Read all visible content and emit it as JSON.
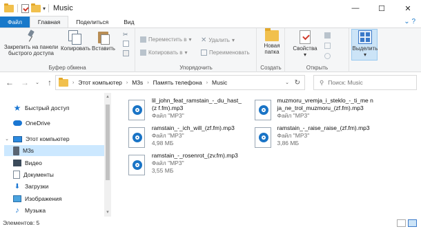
{
  "window": {
    "title": "Music",
    "controls": {
      "minimize": "—",
      "maximize": "☐",
      "close": "✕"
    }
  },
  "ribbon_tabs": [
    "Файл",
    "Главная",
    "Поделиться",
    "Вид"
  ],
  "ribbon": {
    "clipboard": {
      "pin_label": "Закрепить на панели быстрого доступа",
      "copy_label": "Копировать",
      "paste_label": "Вставить",
      "group_label": "Буфер обмена"
    },
    "organize": {
      "move_to": "Переместить в",
      "copy_to": "Копировать в",
      "delete": "Удалить",
      "rename": "Переименовать",
      "group_label": "Упорядочить"
    },
    "create": {
      "new_folder": "Новая папка",
      "group_label": "Создать"
    },
    "open": {
      "properties": "Свойства",
      "group_label": "Открыть"
    },
    "select": {
      "label": "Выделить"
    }
  },
  "address": {
    "crumbs": [
      "Этот компьютер",
      "M3s",
      "Память телефона",
      "Music"
    ],
    "search_placeholder": "Поиск: Music"
  },
  "nav_pane": [
    {
      "label": "Быстрый доступ",
      "icon": "star-icon",
      "expander": ""
    },
    {
      "label": "OneDrive",
      "icon": "cloud-icon",
      "expander": ""
    },
    {
      "label": "Этот компьютер",
      "icon": "computer-icon",
      "expander": "⌄"
    },
    {
      "label": "M3s",
      "icon": "phone-icon",
      "expander": "",
      "selected": true
    },
    {
      "label": "Видео",
      "icon": "video-icon",
      "expander": ""
    },
    {
      "label": "Документы",
      "icon": "document-icon",
      "expander": ""
    },
    {
      "label": "Загрузки",
      "icon": "download-icon",
      "expander": ""
    },
    {
      "label": "Изображения",
      "icon": "image-icon",
      "expander": ""
    },
    {
      "label": "Музыка",
      "icon": "music-icon",
      "expander": ""
    }
  ],
  "files": [
    {
      "name": "lil_john_feat_ramstain_-_du_hast_(zf.fm).mp3",
      "type": "Файл \"MP3\"",
      "size": ""
    },
    {
      "name": "muzmoru_vremja_i_steklo_-_ti_menja_ne_trol_muzmoru_(zf.fm).mp3",
      "type": "Файл \"MP3\"",
      "size": ""
    },
    {
      "name": "ramstain_-_ich_will_(zf.fm).mp3",
      "type": "Файл \"MP3\"",
      "size": "4,98 МБ"
    },
    {
      "name": "ramstain_-_raise_raise_(zf.fm).mp3",
      "type": "Файл \"MP3\"",
      "size": "3,86 МБ"
    },
    {
      "name": "ramstain_-_rosenrot_(zv.fm).mp3",
      "type": "Файл \"MP3\"",
      "size": "3,55 МБ"
    }
  ],
  "file_names_display": [
    "lil_john_feat_ramstain_-_du_hast_(z f.fm).mp3",
    "muzmoru_vremja_i_steklo_-_ti_me nja_ne_trol_muzmoru_(zf.fm).mp3",
    "ramstain_-_ich_will_(zf.fm).mp3",
    "ramstain_-_raise_raise_(zf.fm).mp3",
    "ramstain_-_rosenrot_(zv.fm).mp3"
  ],
  "status": {
    "items_count": "Элементов: 5"
  },
  "colors": {
    "accent": "#1979ca",
    "selection": "#cce8ff",
    "file_tab": "#1979ca"
  }
}
